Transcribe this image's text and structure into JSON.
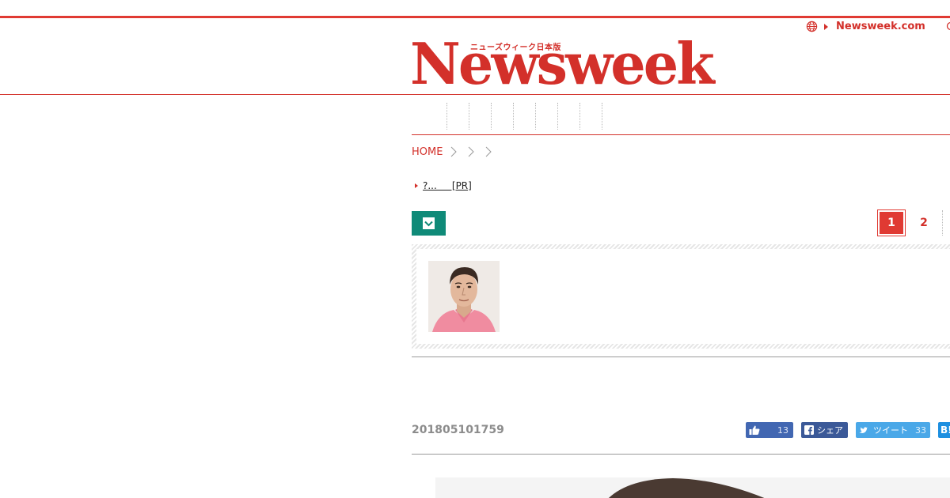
{
  "header": {
    "global_link_label": "Newsweek.com",
    "logo": {
      "wordmark": "Newsweek",
      "tagline": "ニューズウィーク日本版",
      "registered": "®"
    },
    "brand_color": "#d3302a"
  },
  "breadcrumb": {
    "home_label": "HOME"
  },
  "pr_link": {
    "text": "?...     [PR]"
  },
  "pager": {
    "pages": [
      "1",
      "2"
    ],
    "active_page": "1"
  },
  "article": {
    "timestamp": "201805101759"
  },
  "social": {
    "like_count": "13",
    "share_label": "シェア",
    "tweet_label": "ツイート",
    "tweet_count": "33",
    "hatena_label": "B!",
    "like_color": "#4267b2",
    "share_color": "#3b5998",
    "tweet_color": "#4aa8e8",
    "hatena_color": "#1d8fe0"
  },
  "toggle_color": "#0f8a78"
}
